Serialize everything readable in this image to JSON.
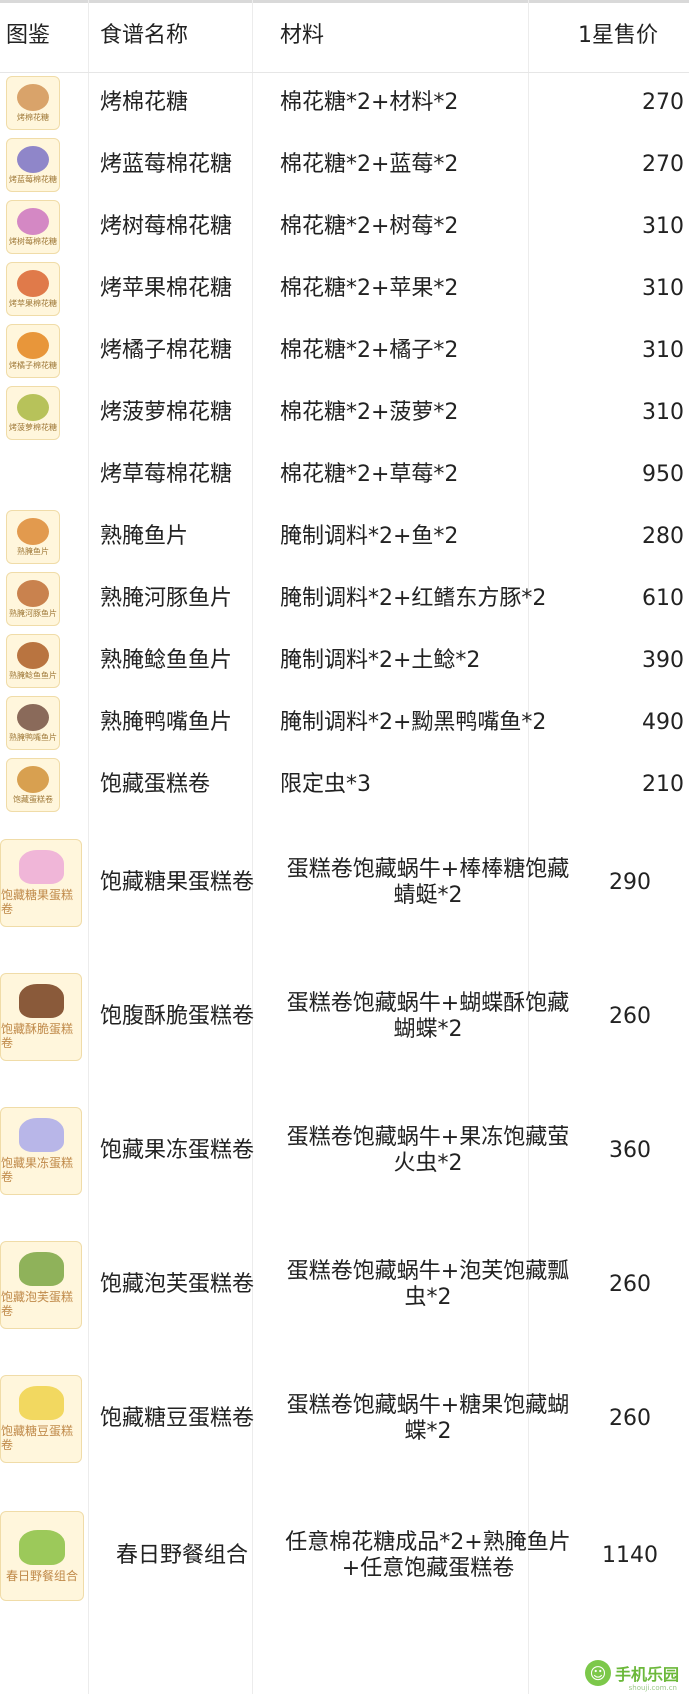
{
  "header": {
    "col_image": "图鉴",
    "col_name": "食谱名称",
    "col_materials": "材料",
    "col_price": "1星售价"
  },
  "rows": [
    {
      "name": "烤棉花糖",
      "materials": "棉花糖*2+材料*2",
      "price": "270",
      "thumb_caption": "烤棉花糖",
      "icon": "roasted-marshmallow-icon",
      "color": "#d9a36a"
    },
    {
      "name": "烤蓝莓棉花糖",
      "materials": "棉花糖*2+蓝莓*2",
      "price": "270",
      "thumb_caption": "烤蓝莓棉花糖",
      "icon": "blueberry-marshmallow-icon",
      "color": "#8f86c9"
    },
    {
      "name": "烤树莓棉花糖",
      "materials": "棉花糖*2+树莓*2",
      "price": "310",
      "thumb_caption": "烤树莓棉花糖",
      "icon": "raspberry-marshmallow-icon",
      "color": "#d488c4"
    },
    {
      "name": "烤苹果棉花糖",
      "materials": "棉花糖*2+苹果*2",
      "price": "310",
      "thumb_caption": "烤苹果棉花糖",
      "icon": "apple-marshmallow-icon",
      "color": "#e07a4a"
    },
    {
      "name": "烤橘子棉花糖",
      "materials": "棉花糖*2+橘子*2",
      "price": "310",
      "thumb_caption": "烤橘子棉花糖",
      "icon": "orange-marshmallow-icon",
      "color": "#e8963a"
    },
    {
      "name": "烤菠萝棉花糖",
      "materials": "棉花糖*2+菠萝*2",
      "price": "310",
      "thumb_caption": "烤菠萝棉花糖",
      "icon": "pineapple-marshmallow-icon",
      "color": "#b7c25a"
    },
    {
      "name": "烤草莓棉花糖",
      "materials": "棉花糖*2+草莓*2",
      "price": "950",
      "thumb_caption": "",
      "icon": "",
      "color": ""
    },
    {
      "name": "熟腌鱼片",
      "materials": "腌制调料*2+鱼*2",
      "price": "280",
      "thumb_caption": "熟腌鱼片",
      "icon": "cured-fish-icon",
      "color": "#e29a4e"
    },
    {
      "name": "熟腌河豚鱼片",
      "materials": "腌制调料*2+红鳍东方豚*2",
      "price": "610",
      "thumb_caption": "熟腌河豚鱼片",
      "icon": "cured-pufferfish-icon",
      "color": "#c9824e"
    },
    {
      "name": "熟腌鲶鱼鱼片",
      "materials": "腌制调料*2+土鲶*2",
      "price": "390",
      "thumb_caption": "熟腌鲶鱼鱼片",
      "icon": "cured-catfish-icon",
      "color": "#b97440"
    },
    {
      "name": "熟腌鸭嘴鱼片",
      "materials": "腌制调料*2+黝黑鸭嘴鱼*2",
      "price": "490",
      "thumb_caption": "熟腌鸭嘴鱼片",
      "icon": "cured-paddlefish-icon",
      "color": "#8a6a5a"
    },
    {
      "name": "饱藏蛋糕卷",
      "materials": "限定虫*3",
      "price": "210",
      "thumb_caption": "饱藏蛋糕卷",
      "icon": "cake-roll-icon",
      "color": "#d8a050"
    },
    {
      "name": "饱藏糖果蛋糕卷",
      "materials": "蛋糕卷饱藏蜗牛+棒棒糖饱藏蜻蜓*2",
      "price": "290",
      "thumb_caption": "饱藏糖果蛋糕卷",
      "icon": "candy-cake-roll-icon",
      "color": "#f0b6d8"
    },
    {
      "name": "饱腹酥脆蛋糕卷",
      "materials": "蛋糕卷饱藏蜗牛+蝴蝶酥饱藏蝴蝶*2",
      "price": "260",
      "thumb_caption": "饱藏酥脆蛋糕卷",
      "icon": "crispy-cake-roll-icon",
      "color": "#8a5a3a"
    },
    {
      "name": "饱藏果冻蛋糕卷",
      "materials": "蛋糕卷饱藏蜗牛+果冻饱藏萤火虫*2",
      "price": "360",
      "thumb_caption": "饱藏果冻蛋糕卷",
      "icon": "jelly-cake-roll-icon",
      "color": "#b8b6e8"
    },
    {
      "name": "饱藏泡芙蛋糕卷",
      "materials": "蛋糕卷饱藏蜗牛+泡芙饱藏瓢虫*2",
      "price": "260",
      "thumb_caption": "饱藏泡芙蛋糕卷",
      "icon": "puff-cake-roll-icon",
      "color": "#8fb25a"
    },
    {
      "name": "饱藏糖豆蛋糕卷",
      "materials": "蛋糕卷饱藏蜗牛+糖果饱藏蝴蝶*2",
      "price": "260",
      "thumb_caption": "饱藏糖豆蛋糕卷",
      "icon": "jellybean-cake-roll-icon",
      "color": "#f2d860"
    },
    {
      "name": "春日野餐组合",
      "materials": "任意棉花糖成品*2+熟腌鱼片+任意饱藏蛋糕卷",
      "price": "1140",
      "thumb_caption": "春日野餐组合",
      "icon": "picnic-basket-icon",
      "color": "#9cc95a"
    }
  ],
  "watermark": {
    "text": "手机乐园",
    "url": "shouji.com.cn",
    "icon": "smiley-icon"
  }
}
